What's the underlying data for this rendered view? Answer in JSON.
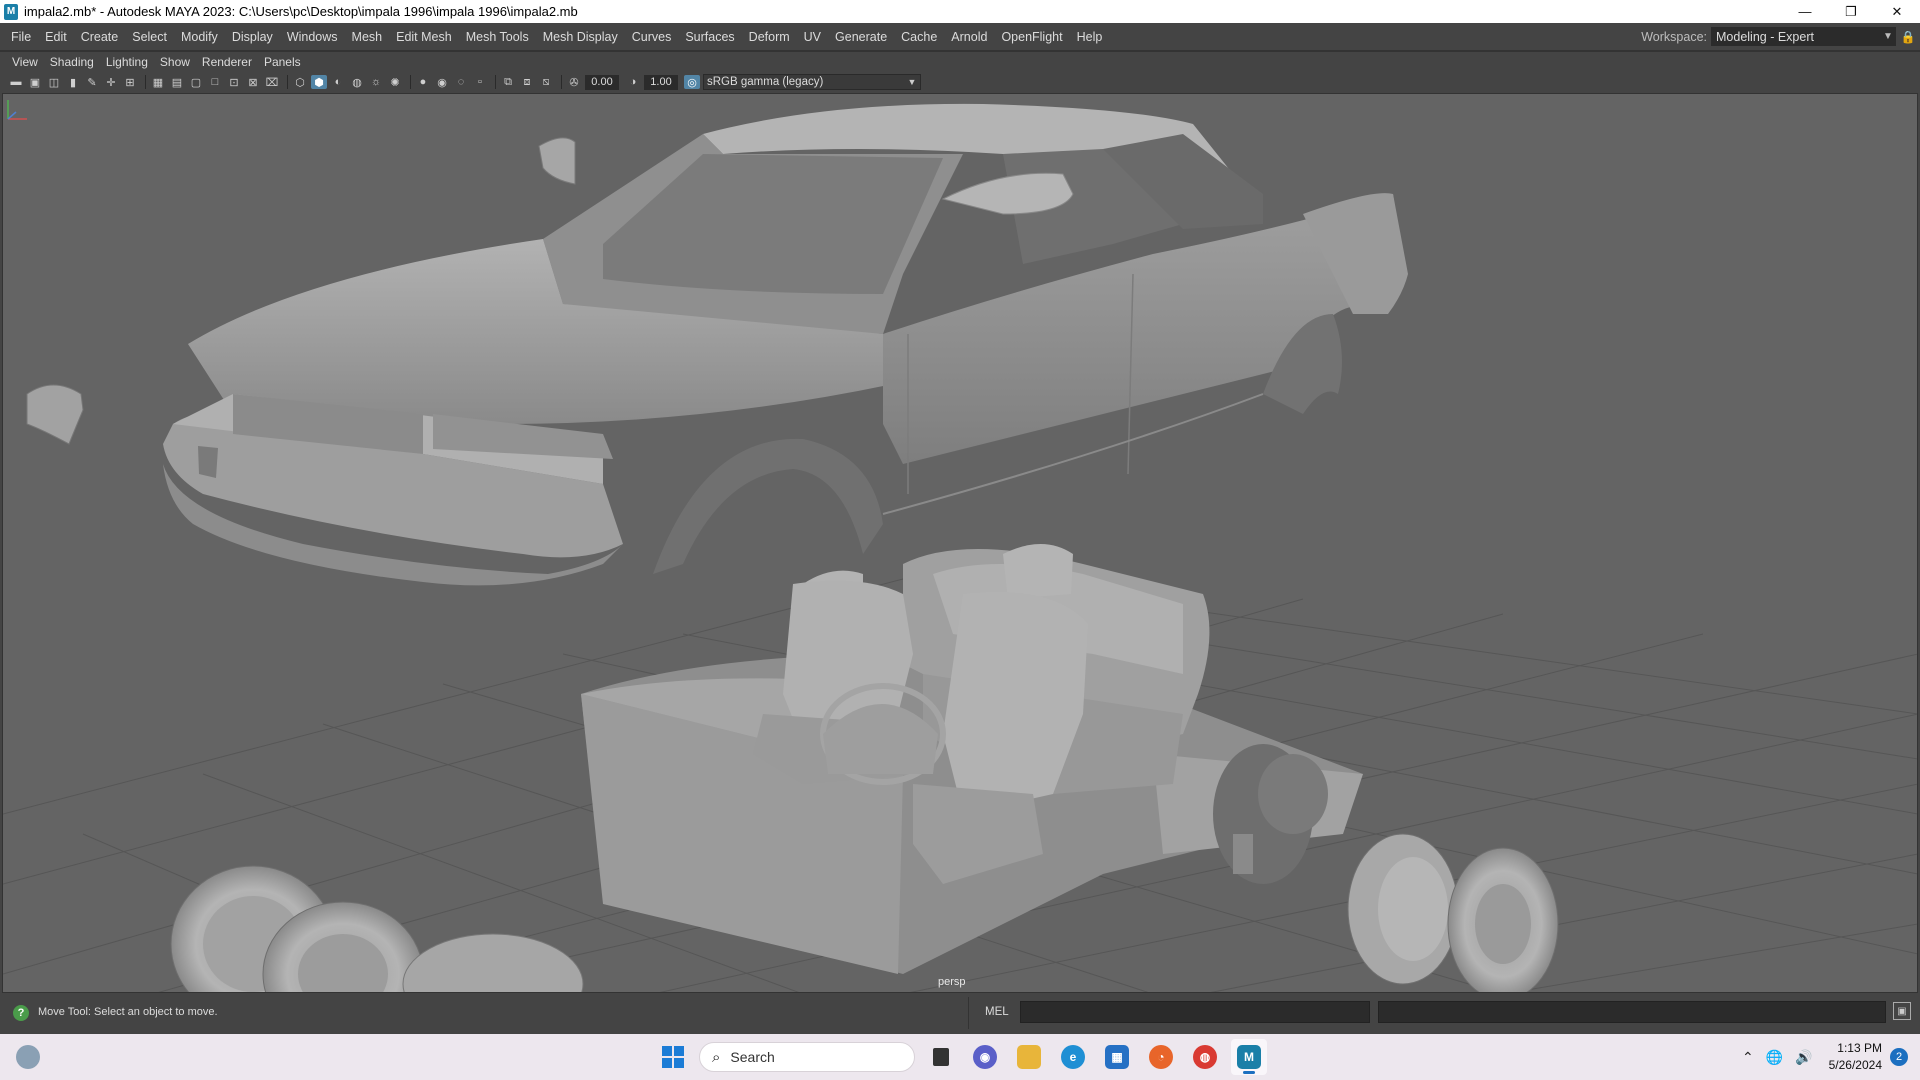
{
  "window": {
    "app_icon": "M",
    "title": "impala2.mb* - Autodesk MAYA 2023: C:\\Users\\pc\\Desktop\\impala 1996\\impala 1996\\impala2.mb",
    "minimize": "—",
    "restore": "❐",
    "close": "✕"
  },
  "menubar": {
    "items": [
      "File",
      "Edit",
      "Create",
      "Select",
      "Modify",
      "Display",
      "Windows",
      "Mesh",
      "Edit Mesh",
      "Mesh Tools",
      "Mesh Display",
      "Curves",
      "Surfaces",
      "Deform",
      "UV",
      "Generate",
      "Cache",
      "Arnold",
      "OpenFlight",
      "Help"
    ],
    "workspace_label": "Workspace:",
    "workspace_value": "Modeling - Expert"
  },
  "panel_menu": {
    "items": [
      "View",
      "Shading",
      "Lighting",
      "Show",
      "Renderer",
      "Panels"
    ]
  },
  "panel_toolbar": {
    "exposure": "0.00",
    "gamma": "1.00",
    "color_management": "sRGB gamma (legacy)"
  },
  "viewport": {
    "camera_label": "persp",
    "background_color": "#646464",
    "model_color": "#a8a8a8",
    "grid_color": "#555555"
  },
  "status": {
    "help_line": "Move Tool: Select an object to move.",
    "command_language": "MEL"
  },
  "taskbar": {
    "search_placeholder": "Search",
    "time": "1:13 PM",
    "date": "5/26/2024",
    "notifications": "2",
    "accent": "#1c6fc0"
  }
}
